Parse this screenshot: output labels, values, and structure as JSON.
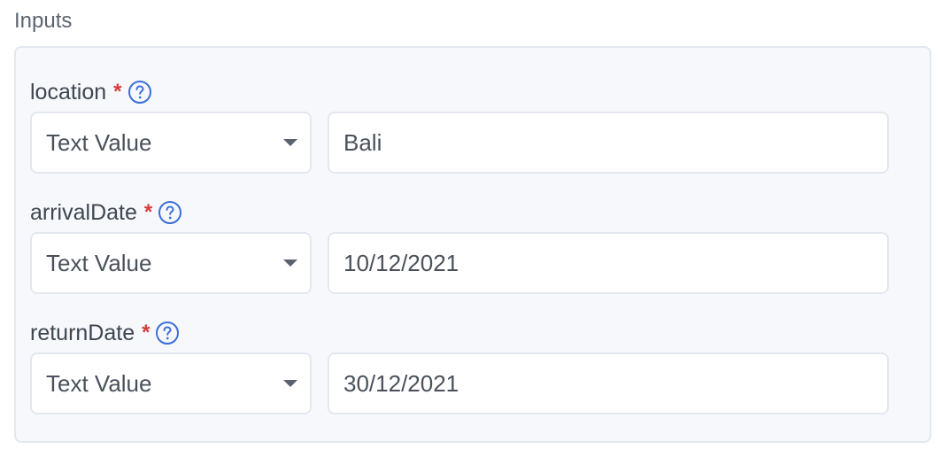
{
  "section": {
    "title": "Inputs"
  },
  "fields": [
    {
      "label": "location",
      "required_mark": "*",
      "type": "Text Value",
      "value": "Bali"
    },
    {
      "label": "arrivalDate",
      "required_mark": "*",
      "type": "Text Value",
      "value": "10/12/2021"
    },
    {
      "label": "returnDate",
      "required_mark": "*",
      "type": "Text Value",
      "value": "30/12/2021"
    }
  ],
  "icons": {
    "help": "help-circle-icon",
    "dropdown": "caret-down-icon"
  },
  "colors": {
    "required": "#d93a3a",
    "help_icon": "#3b6fd8",
    "panel_bg": "#f6f8fb",
    "border": "#e4e8ee"
  }
}
